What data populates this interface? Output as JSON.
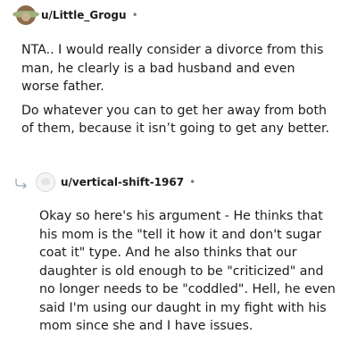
{
  "comments": [
    {
      "username": "u/Little_Grogu",
      "separator": "•",
      "paragraphs": [
        "NTA.. I would really consider a divorce from this man, he clearly is a bad husband and even worse father.",
        "Do whatever you can to get her away from both of them, because it isn’t going to get any better."
      ]
    },
    {
      "username": "u/vertical-shift-1967",
      "separator": "•",
      "paragraphs": [
        "Okay so here's his argument - He thinks that his mom is the \"tell it how it and don't sugar coat it\" type. And he also thinks that our daughter is old enough to be \"criticized\" and no longer needs to be \"coddled\". Hell, he even said I'm using our daught in my fight with his mom since she and I have issues."
      ]
    }
  ],
  "colors": {
    "text": "#1c1c1c",
    "meta": "#7c7c7c",
    "background": "#ffffff"
  },
  "icons": {
    "reply": "reply-arrow-icon",
    "avatar1": "grogu-avatar-icon",
    "avatar2": "default-avatar-icon"
  }
}
